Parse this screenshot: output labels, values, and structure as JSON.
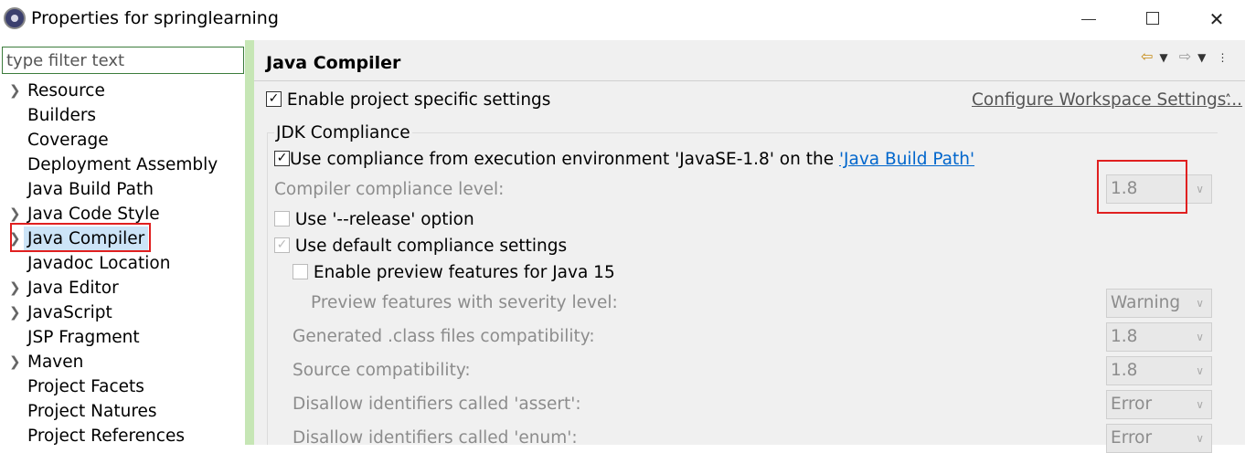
{
  "window": {
    "title": "Properties for springlearning",
    "minimize": "",
    "maximize": "",
    "close": "✕"
  },
  "filter": {
    "placeholder": "type filter text",
    "value": ""
  },
  "tree": [
    {
      "label": "Resource",
      "expandable": true
    },
    {
      "label": "Builders",
      "expandable": false
    },
    {
      "label": "Coverage",
      "expandable": false
    },
    {
      "label": "Deployment Assembly",
      "expandable": false
    },
    {
      "label": "Java Build Path",
      "expandable": false
    },
    {
      "label": "Java Code Style",
      "expandable": true
    },
    {
      "label": "Java Compiler",
      "expandable": true,
      "selected": true
    },
    {
      "label": "Javadoc Location",
      "expandable": false
    },
    {
      "label": "Java Editor",
      "expandable": true
    },
    {
      "label": "JavaScript",
      "expandable": true
    },
    {
      "label": "JSP Fragment",
      "expandable": false
    },
    {
      "label": "Maven",
      "expandable": true
    },
    {
      "label": "Project Facets",
      "expandable": false
    },
    {
      "label": "Project Natures",
      "expandable": false
    },
    {
      "label": "Project References",
      "expandable": false
    }
  ],
  "page": {
    "title": "Java Compiler",
    "enable_specific": {
      "label": "Enable project specific settings",
      "checked": true
    },
    "configure_link": "Configure Workspace Settings...",
    "group_title": "JDK Compliance",
    "use_compliance": {
      "label": "Use compliance from execution environment 'JavaSE-1.8' on the ",
      "link": "'Java Build Path'",
      "checked": true
    },
    "compliance_level": {
      "label": "Compiler compliance level:",
      "value": "1.8"
    },
    "release_option": {
      "label": "Use '--release' option",
      "checked": false
    },
    "default_compliance": {
      "label": "Use default compliance settings",
      "checked": true
    },
    "preview_features": {
      "label": "Enable preview features for Java 15",
      "checked": false
    },
    "preview_severity": {
      "label": "Preview features with severity level:",
      "value": "Warning"
    },
    "class_compat": {
      "label": "Generated .class files compatibility:",
      "value": "1.8"
    },
    "source_compat": {
      "label": "Source compatibility:",
      "value": "1.8"
    },
    "assert_ident": {
      "label": "Disallow identifiers called 'assert':",
      "value": "Error"
    },
    "enum_ident": {
      "label": "Disallow identifiers called 'enum':",
      "value": "Error"
    }
  },
  "icons": {
    "back": "back-arrow-icon",
    "forward": "forward-arrow-icon",
    "menu": "view-menu-icon"
  },
  "colors": {
    "selection_highlight": "#cce4f7",
    "annotation_red": "#e02020",
    "splitter_green": "#c6e6b5",
    "link_blue": "#0066cc"
  }
}
